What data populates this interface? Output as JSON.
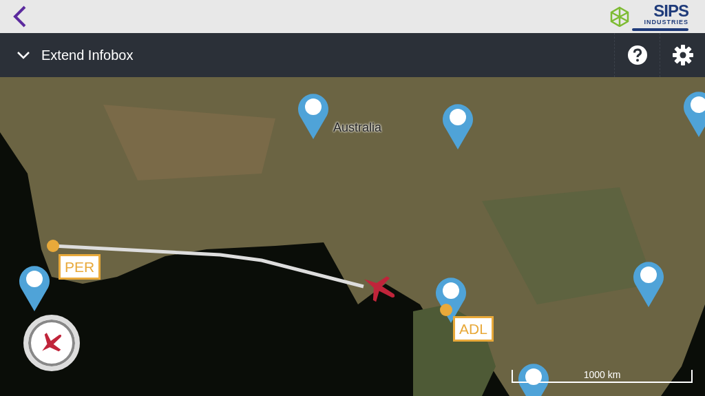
{
  "top_bar": {
    "logo": {
      "name": "SIPS",
      "subtitle": "INDUSTRIES"
    }
  },
  "infobox_bar": {
    "title": "Extend Infobox",
    "expanded": false
  },
  "map": {
    "place_label": "Australia",
    "airports": [
      {
        "code": "PER"
      },
      {
        "code": "ADL"
      }
    ],
    "scale": "1000 km"
  }
}
